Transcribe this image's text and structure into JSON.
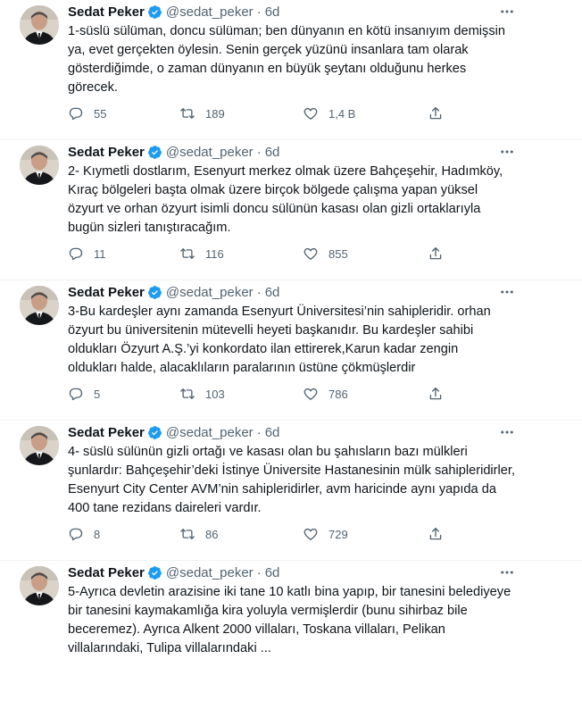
{
  "tweets": [
    {
      "name": "Sedat Peker",
      "handle": "@sedat_peker",
      "separator": "·",
      "time": "6d",
      "text": "1-süslü sülüman, doncu sülüman; ben dünyanın en kötü insanıyım demişsin\nya, evet gerçekten öylesin. Senin gerçek yüzünü insanlara tam olarak\ngösterdiğimde, o zaman dünyanın en büyük şeytanı olduğunu herkes\ngörecek.",
      "replies": "55",
      "retweets": "189",
      "likes": "1,4 B"
    },
    {
      "name": "Sedat Peker",
      "handle": "@sedat_peker",
      "separator": "·",
      "time": "6d",
      "text": "2- Kıymetli dostlarım, Esenyurt merkez olmak üzere Bahçeşehir, Hadımköy,\nKıraç bölgeleri başta olmak üzere birçok bölgede çalışma yapan yüksel\nözyurt ve orhan özyurt isimli doncu sülünün kasası olan gizli ortaklarıyla\nbugün sizleri tanıştıracağım.",
      "replies": "11",
      "retweets": "116",
      "likes": "855"
    },
    {
      "name": "Sedat Peker",
      "handle": "@sedat_peker",
      "separator": "·",
      "time": "6d",
      "text": "3-Bu kardeşler aynı zamanda Esenyurt  Üniversitesi’nin sahipleridir. orhan\nözyurt bu üniversitenin mütevelli heyeti başkanıdır. Bu kardeşler sahibi\noldukları Özyurt A.Ş.’yi konkordato ilan ettirerek,Karun kadar zengin\noldukları halde, alacaklıların paralarının üstüne çökmüşlerdir",
      "replies": "5",
      "retweets": "103",
      "likes": "786"
    },
    {
      "name": "Sedat Peker",
      "handle": "@sedat_peker",
      "separator": "·",
      "time": "6d",
      "text": "4- süslü sülünün gizli ortağı ve kasası olan bu şahısların bazı mülkleri\nşunlardır: Bahçeşehir’deki İstinye Üniversite Hastanesinin mülk sahipleridirler,\nEsenyurt City Center AVM’nin sahipleridirler, avm haricinde aynı yapıda da\n400 tane rezidans daireleri vardır.",
      "replies": "8",
      "retweets": "86",
      "likes": "729"
    },
    {
      "name": "Sedat Peker",
      "handle": "@sedat_peker",
      "separator": "·",
      "time": "6d",
      "text": "5-Ayrıca devletin arazisine iki tane 10 katlı bina yapıp, bir tanesini belediyeye\nbir tanesini kaymakamlığa kira yoluyla vermişlerdir (bunu sihirbaz bile\nbeceremez).  Ayrıca Alkent 2000 villaları, Toskana villaları, Pelikan\nvillalarındaki, Tulipa villalarındaki ...",
      "replies": "",
      "retweets": "",
      "likes": ""
    }
  ],
  "icons": {
    "avatar": "profile-photo",
    "verified": "verified-badge-icon",
    "more": "more-icon",
    "reply": "reply-icon",
    "retweet": "retweet-icon",
    "like": "like-icon",
    "share": "share-icon"
  },
  "colors": {
    "text": "#0f1419",
    "secondary": "#536471",
    "verified": "#1d9bf0",
    "divider": "#eff3f4"
  }
}
